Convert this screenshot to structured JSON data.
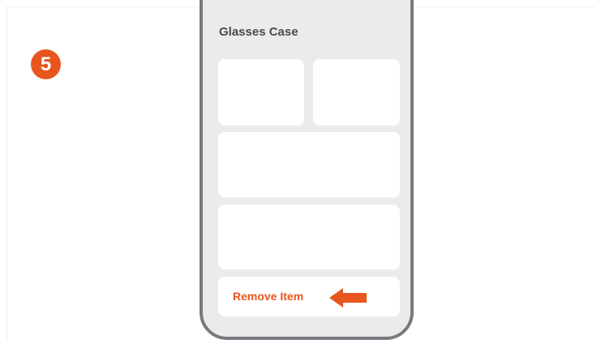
{
  "step": {
    "number": "5"
  },
  "panel": {
    "title": "Glasses Case",
    "remove_label": "Remove Item"
  },
  "colors": {
    "accent": "#e8561f",
    "phone_frame": "#777b80",
    "phone_screen": "#ebebeb",
    "card": "#ffffff",
    "title_text": "#4a4a4a"
  },
  "icons": {
    "step_badge": "step-number-badge",
    "pointer": "left-arrow-icon"
  }
}
